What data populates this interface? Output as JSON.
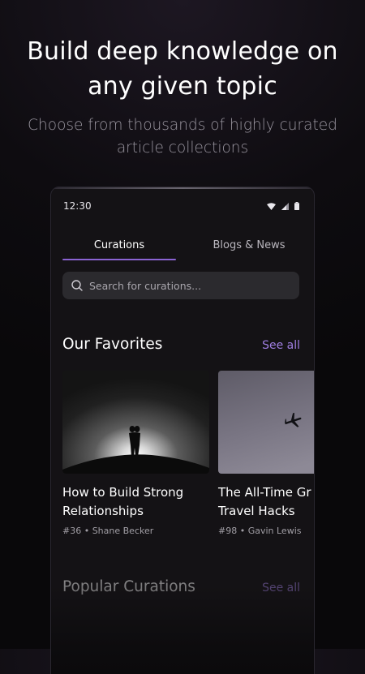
{
  "hero": {
    "title_line1": "Build deep knowledge on",
    "title_line2": "any given topic",
    "subtitle_line1": "Choose from thousands of highly curated",
    "subtitle_line2": "article collections"
  },
  "status_bar": {
    "time": "12:30",
    "icons": [
      "wifi-icon",
      "cellular-signal-icon",
      "battery-icon"
    ]
  },
  "tabs": [
    {
      "label": "Curations",
      "active": true
    },
    {
      "label": "Blogs & News",
      "active": false
    }
  ],
  "search": {
    "placeholder": "Search for curations..."
  },
  "favorites": {
    "title": "Our Favorites",
    "see_all": "See all",
    "cards": [
      {
        "title_line1": "How to Build Strong",
        "title_line2": "Relationships",
        "meta": "#36 • Shane Becker"
      },
      {
        "title_line1": "The All-Time Gr",
        "title_line2": "Travel Hacks",
        "meta": "#98 • Gavin Lewis"
      }
    ]
  },
  "popular": {
    "title": "Popular Curations",
    "see_all": "See all"
  },
  "colors": {
    "accent": "#8a63d2",
    "link": "#9f7ee0",
    "background": "#0e0c10",
    "panel": "#141215",
    "search_bg": "#2b2a2e"
  }
}
